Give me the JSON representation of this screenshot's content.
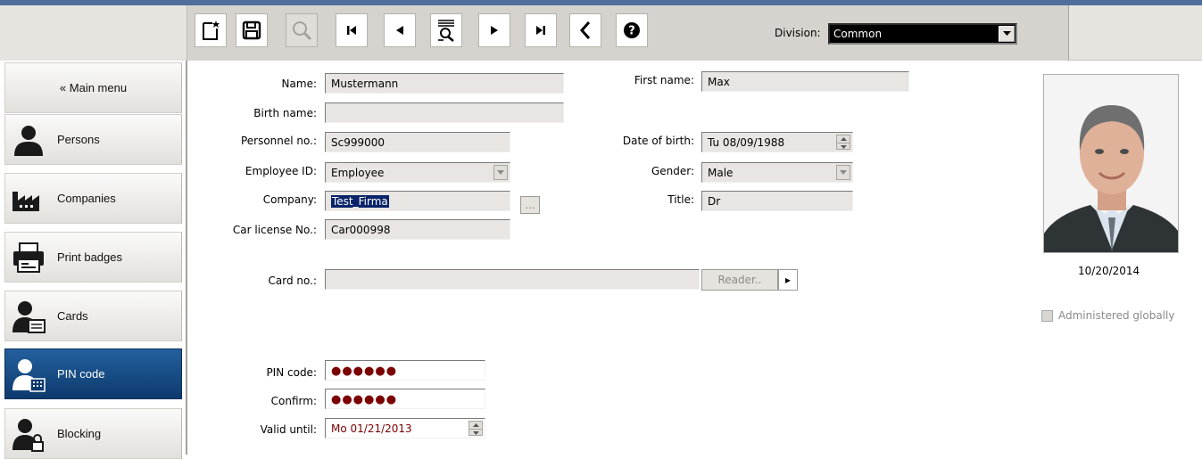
{
  "toolbar": {
    "division_label": "Division:",
    "division_value": "Common",
    "buttons": [
      "new-record",
      "save",
      "search",
      "first",
      "previous",
      "filter",
      "next",
      "last",
      "back",
      "help"
    ]
  },
  "sidebar": {
    "items": [
      {
        "label": "« Main menu"
      },
      {
        "label": "Persons"
      },
      {
        "label": "Companies"
      },
      {
        "label": "Print badges"
      },
      {
        "label": "Cards"
      },
      {
        "label": "PIN code",
        "active": true
      },
      {
        "label": "Blocking"
      }
    ]
  },
  "form": {
    "name": {
      "label": "Name:",
      "value": "Mustermann"
    },
    "first_name": {
      "label": "First name:",
      "value": "Max"
    },
    "birth_name": {
      "label": "Birth name:",
      "value": ""
    },
    "personnel_no": {
      "label": "Personnel no.:",
      "value": "Sc999000"
    },
    "date_of_birth": {
      "label": "Date of birth:",
      "value": "Tu 08/09/1988"
    },
    "employee_id": {
      "label": "Employee ID:",
      "value": "Employee"
    },
    "gender": {
      "label": "Gender:",
      "value": "Male"
    },
    "company": {
      "label": "Company:",
      "value": "Test_Firma",
      "browse": "..."
    },
    "title": {
      "label": "Title:",
      "value": "Dr"
    },
    "car_license": {
      "label": "Car license No.:",
      "value": "Car000998"
    },
    "card_no": {
      "label": "Card no.:",
      "value": "",
      "reader_button": "Reader..",
      "reader_arrow": "▸"
    },
    "pin_code": {
      "label": "PIN code:",
      "value": "●●●●●●"
    },
    "confirm": {
      "label": "Confirm:",
      "value": "●●●●●●"
    },
    "valid_until": {
      "label": "Valid until:",
      "value": "Mo 01/21/2013"
    }
  },
  "photo": {
    "date": "10/20/2014"
  },
  "administered_globally": {
    "label": "Administered globally",
    "checked": false
  },
  "colors": {
    "accent": "#1b5089",
    "pin_text": "#7b0000",
    "top_line": "#4f6e9e"
  }
}
